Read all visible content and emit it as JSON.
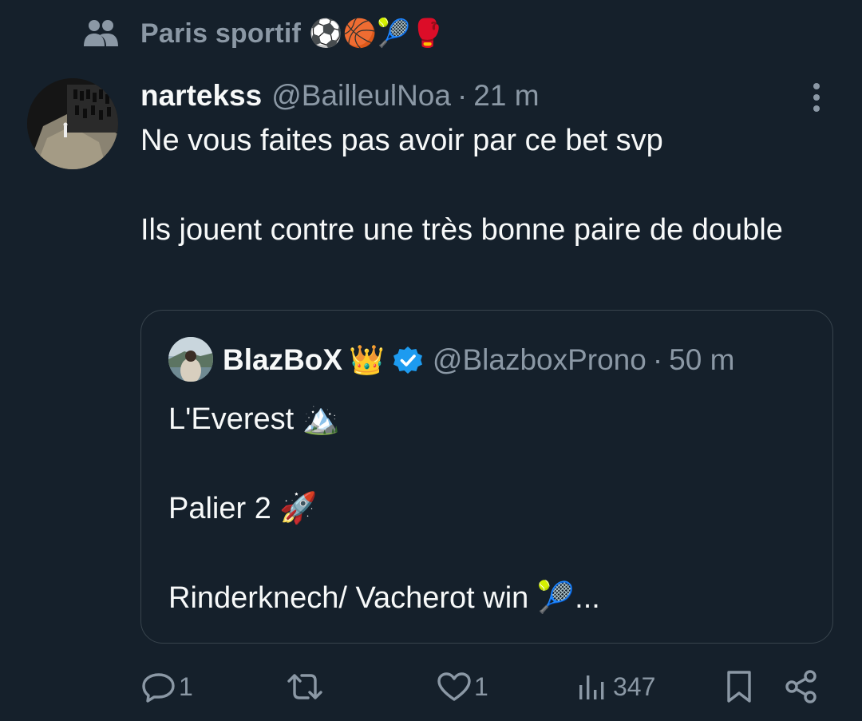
{
  "community": {
    "label": "Paris sportif",
    "emojis": "⚽🏀🎾🥊"
  },
  "tweet": {
    "author_name": "nartekss",
    "author_handle": "@BailleulNoa",
    "separator": "·",
    "time": "21 m",
    "lines": [
      "Ne vous faites pas avoir par ce bet svp",
      "Ils jouent contre une très bonne paire de double"
    ]
  },
  "quote": {
    "author_name": "BlazBoX",
    "crown": "👑",
    "author_handle": "@BlazboxProno",
    "separator": "·",
    "time": "50 m",
    "lines": [
      "L'Everest 🏔️",
      "Palier 2 🚀",
      "Rinderknech/ Vacherot win 🎾..."
    ]
  },
  "actions": {
    "replies": "1",
    "reposts": "",
    "likes": "1",
    "views": "347"
  },
  "colors": {
    "background": "#15202b",
    "text": "#f7f9f9",
    "muted": "#8b98a5",
    "border": "#38444d",
    "verified": "#1d9bf0"
  }
}
